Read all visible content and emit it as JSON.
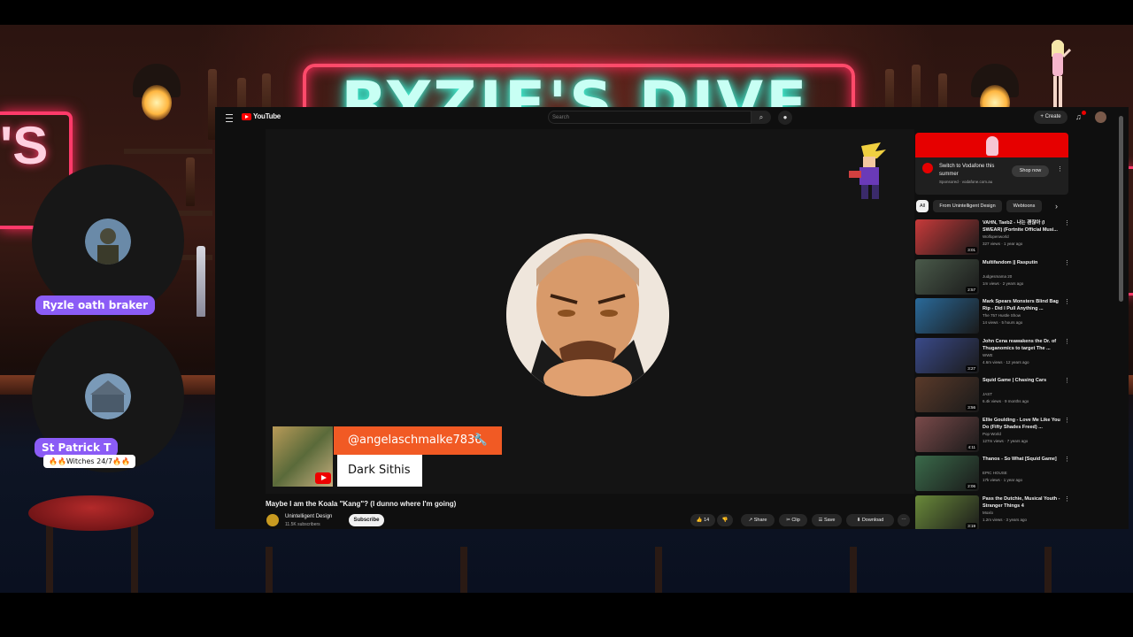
{
  "background": {
    "neon_sign": "RYZIE'S DIVE BAR",
    "neon_left": "'S",
    "accent_pink": "#ff3a6a",
    "accent_cyan": "#46ffe0"
  },
  "cams": [
    {
      "name": "Ryzle oath braker",
      "sub": ""
    },
    {
      "name": "St Patrick T",
      "sub": "🔥🔥Witches 24/7🔥🔥"
    }
  ],
  "youtube": {
    "logo": "YouTube",
    "search_placeholder": "Search",
    "create": "+ Create",
    "video_title": "Maybe I am the Koala \"Kang\"? (I dunno where I'm going)",
    "channel": "Unintelligent Design",
    "subscribers": "11.5K subscribers",
    "subscribe": "Subscribe",
    "overlay_handle": "@angelaschmalke7836",
    "overlay_name": "Dark Sithis",
    "actions": {
      "likes": "14",
      "share": "Share",
      "clip": "Clip",
      "save": "Save",
      "download": "Download"
    },
    "ad": {
      "headline": "Switch to Vodafone this summer",
      "sponsored": "Sponsored · vodafone.com.au",
      "cta": "Shop now"
    },
    "chips": [
      "All",
      "From Unintelligent Design",
      "Webtoons"
    ],
    "recommendations": [
      {
        "title": "VAHN, Taeb2 - 나는 괜찮아 (I SWEAR) (Fortnite Official Musi...",
        "channel": "Wolfopenworld",
        "meta": "327 views · 1 year ago",
        "duration": "3:01",
        "color": "#c83a3a"
      },
      {
        "title": "Multifandom || Rasputin",
        "channel": "Judgesmama 20",
        "meta": "1m views · 2 years ago",
        "duration": "2:57",
        "color": "#4a5a4a"
      },
      {
        "title": "Mark Spears Monsters Blind Bag Rip - Did I Pull Anything ...",
        "channel": "The 757 Hustle Show",
        "meta": "14 views · 5 hours ago",
        "duration": "",
        "color": "#2a6a9a"
      },
      {
        "title": "John Cena reawakens the Dr. of Thuganomics to target The ...",
        "channel": "WWE",
        "meta": "4.6m views · 12 years ago",
        "duration": "3:27",
        "color": "#3a4a8a"
      },
      {
        "title": "Squid Game | Chasing Cars",
        "channel": "JAST",
        "meta": "6.4k views · 9 months ago",
        "duration": "3:56",
        "color": "#5a3a2a"
      },
      {
        "title": "Ellie Goulding - Love Me Like You Do (Fifty Shades Freed) ...",
        "channel": "Pop World",
        "meta": "127m views · 7 years ago",
        "duration": "4:11",
        "color": "#7a4a4a"
      },
      {
        "title": "Thanos - So What [Squid Game]",
        "channel": "EPIC HOUSE",
        "meta": "17k views · 1 year ago",
        "duration": "2:06",
        "color": "#3a6a4a"
      },
      {
        "title": "Pass the Dutchie, Musical Youth - Stranger Things 4",
        "channel": "Moxlo",
        "meta": "1.2m views · 3 years ago",
        "duration": "3:19",
        "color": "#6a8a3a"
      }
    ]
  }
}
